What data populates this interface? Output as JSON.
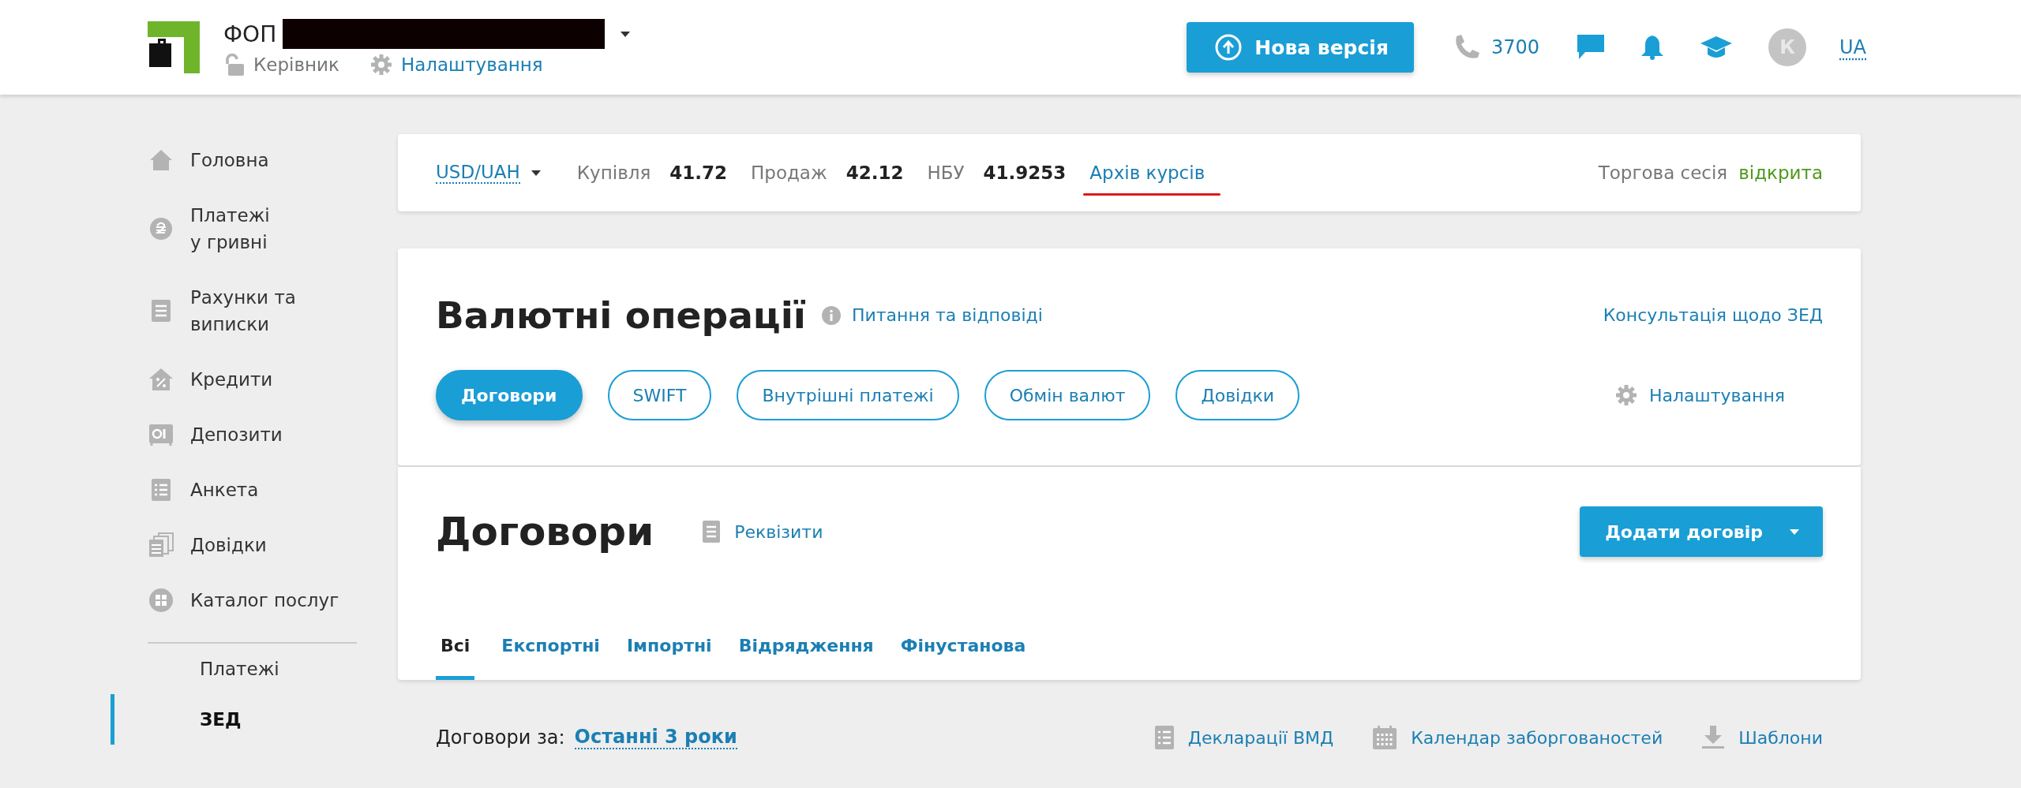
{
  "header": {
    "company_prefix": "ФОП",
    "role": "Керівник",
    "settings": "Налаштування",
    "new_version": "Нова версія",
    "phone": "3700",
    "avatar_letter": "К",
    "languages": [
      {
        "label": "UA",
        "selected": true
      }
    ]
  },
  "sidebar": {
    "items": [
      {
        "label": "Головна",
        "selected": false
      },
      {
        "label": "Платежі\nу гривні",
        "selected": false
      },
      {
        "label": "Рахунки та\nвиписки",
        "selected": false
      },
      {
        "label": "Кредити",
        "selected": false
      },
      {
        "label": "Депозити",
        "selected": false
      },
      {
        "label": "Анкета",
        "selected": false
      },
      {
        "label": "Довідки",
        "selected": false
      },
      {
        "label": "Каталог послуг",
        "selected": false
      }
    ],
    "sub_items": [
      {
        "label": "Платежі",
        "selected": false
      },
      {
        "label": "ЗЕД",
        "selected": true
      }
    ]
  },
  "rates": {
    "pair": "USD/UAH",
    "buy_label": "Купівля",
    "buy": "41.72",
    "sell_label": "Продаж",
    "sell": "42.12",
    "nbu_label": "НБУ",
    "nbu": "41.9253",
    "archive_link": "Архів курсів",
    "session_label": "Торгова сесія",
    "session_status": "відкрита"
  },
  "operations": {
    "title": "Валютні операції",
    "help_link": "Питання та відповіді",
    "consult_link": "Консультація щодо ЗЕД",
    "tabs": [
      {
        "label": "Договори",
        "selected": true
      },
      {
        "label": "SWIFT",
        "selected": false
      },
      {
        "label": "Внутрішні платежі",
        "selected": false
      },
      {
        "label": "Обмін валют",
        "selected": false
      },
      {
        "label": "Довідки",
        "selected": false
      }
    ],
    "settings_link": "Налаштування"
  },
  "contracts": {
    "title": "Договори",
    "requisites_link": "Реквізити",
    "add_button": "Додати договір",
    "tabs": [
      {
        "label": "Всі",
        "selected": true
      },
      {
        "label": "Експортні",
        "selected": false
      },
      {
        "label": "Імпортні",
        "selected": false
      },
      {
        "label": "Відрядження",
        "selected": false
      },
      {
        "label": "Фінустанова",
        "selected": false
      }
    ]
  },
  "filter": {
    "label": "Договори за:",
    "period": "Останні 3 роки",
    "links": [
      "Декларації ВМД",
      "Календар заборгованостей",
      "Шаблони"
    ]
  }
}
